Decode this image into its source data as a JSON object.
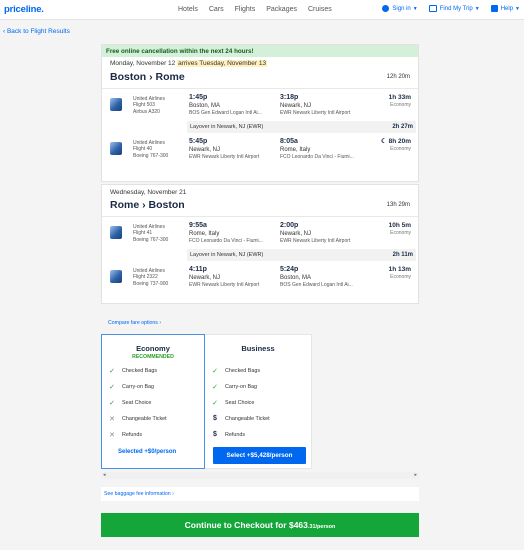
{
  "header": {
    "logo": "priceline",
    "nav": [
      "Hotels",
      "Cars",
      "Flights",
      "Packages",
      "Cruises"
    ],
    "sign_in": "Sign in",
    "find_trip": "Find My Trip",
    "help": "Help"
  },
  "back_link": "‹ Back to Flight Results",
  "banner": "Free online cancellation within the next 24 hours!",
  "outbound": {
    "date": "Monday, November 12",
    "arrives": "arrives Tuesday, November 13",
    "route": "Boston › Rome",
    "duration": "12h 20m",
    "seg1": {
      "airline": "United Airlines",
      "flight": "Flight 503",
      "aircraft": "Airbus A320",
      "dep_time": "1:45p",
      "dep_city": "Boston, MA",
      "dep_airport": "BOS Gen Edward Logan Intl Ai...",
      "arr_time": "3:18p",
      "arr_city": "Newark, NJ",
      "arr_airport": "EWR Newark Liberty Intl Airport",
      "duration": "1h 33m",
      "cabin": "Economy"
    },
    "layover": "Layover in Newark, NJ (EWR)",
    "layover_time": "2h 27m",
    "seg2": {
      "airline": "United Airlines",
      "flight": "Flight 40",
      "aircraft": "Boeing 767-300",
      "dep_time": "5:45p",
      "dep_city": "Newark, NJ",
      "dep_airport": "EWR Newark Liberty Intl Airport",
      "arr_time": "8:05a",
      "arr_city": "Rome, Italy",
      "arr_airport": "FCO Leonardo Da Vinci - Fiumi...",
      "duration": "8h 20m",
      "cabin": "Economy"
    }
  },
  "inbound": {
    "date": "Wednesday, November 21",
    "route": "Rome › Boston",
    "duration": "13h 29m",
    "seg1": {
      "airline": "United Airlines",
      "flight": "Flight 41",
      "aircraft": "Boeing 767-300",
      "dep_time": "9:55a",
      "dep_city": "Rome, Italy",
      "dep_airport": "FCO Leonardo Da Vinci - Fiumi...",
      "arr_time": "2:00p",
      "arr_city": "Newark, NJ",
      "arr_airport": "EWR Newark Liberty Intl Airport",
      "duration": "10h 5m",
      "cabin": "Economy"
    },
    "layover": "Layover in Newark, NJ (EWR)",
    "layover_time": "2h 11m",
    "seg2": {
      "airline": "United Airlines",
      "flight": "Flight 2322",
      "aircraft": "Boeing 737-900",
      "dep_time": "4:11p",
      "dep_city": "Newark, NJ",
      "dep_airport": "EWR Newark Liberty Intl Airport",
      "arr_time": "5:24p",
      "arr_city": "Boston, MA",
      "arr_airport": "BOS Gen Edward Logan Intl Ai...",
      "duration": "1h 13m",
      "cabin": "Economy"
    }
  },
  "compare": "Compare fare options",
  "economy": {
    "title": "Economy",
    "badge": "RECOMMENDED",
    "features": [
      "Checked Bags",
      "Carry-on Bag",
      "Seat Choice",
      "Changeable Ticket",
      "Refunds"
    ],
    "selected": "Selected +$0/person"
  },
  "business": {
    "title": "Business",
    "features": [
      "Checked Bags",
      "Carry-on Bag",
      "Seat Choice",
      "Changeable Ticket",
      "Refunds"
    ],
    "select": "Select +$5,428/person"
  },
  "baggage": "See baggage fee information",
  "checkout": {
    "label": "Continue to Checkout for $463",
    "cents": ".31/person"
  },
  "colors": {
    "brand": "#0068ef",
    "green": "#15a639",
    "banner": "#d5f0d8"
  }
}
